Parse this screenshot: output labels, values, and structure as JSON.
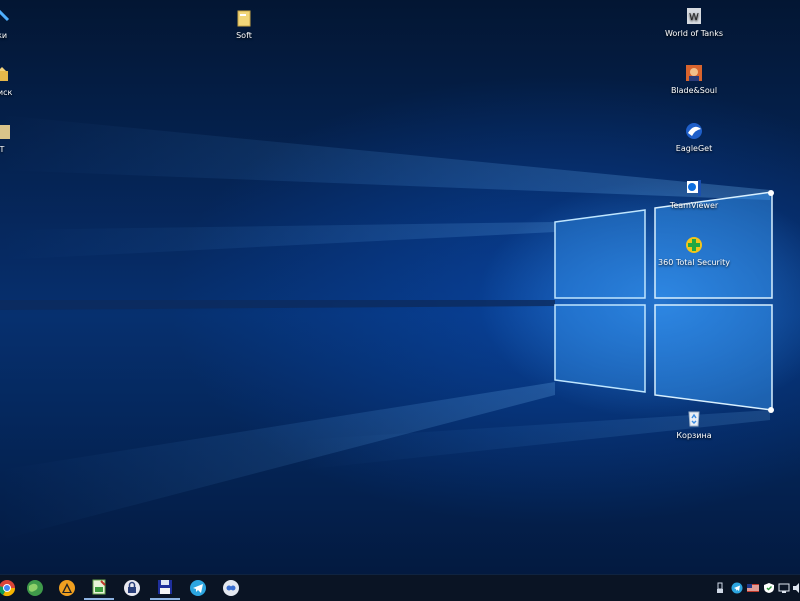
{
  "desktop": {
    "icons": [
      {
        "name": "desktop-icon-partial-1",
        "label": "зки"
      },
      {
        "name": "desktop-icon-yandex-disk",
        "label": "Диск"
      },
      {
        "name": "desktop-icon-partial-3",
        "label": "T"
      },
      {
        "name": "desktop-icon-soft",
        "label": "Soft"
      },
      {
        "name": "desktop-icon-world-of-tanks",
        "label": "World of Tanks"
      },
      {
        "name": "desktop-icon-blade-and-soul",
        "label": "Blade&Soul"
      },
      {
        "name": "desktop-icon-eagleget",
        "label": "EagleGet"
      },
      {
        "name": "desktop-icon-teamviewer",
        "label": "TeamViewer"
      },
      {
        "name": "desktop-icon-360-total-security",
        "label": "360 Total Security"
      },
      {
        "name": "desktop-icon-recycle-bin",
        "label": "Корзина"
      }
    ]
  },
  "taskbar": {
    "pinned": [
      {
        "name": "taskbar-chrome-button",
        "icon": "chrome-icon"
      },
      {
        "name": "taskbar-globe-button",
        "icon": "globe-icon"
      },
      {
        "name": "taskbar-aimp-button",
        "icon": "aimp-icon"
      },
      {
        "name": "taskbar-image-editor-button",
        "icon": "image-editor-icon",
        "active": true
      },
      {
        "name": "taskbar-lock-button",
        "icon": "lock-icon"
      },
      {
        "name": "taskbar-save-button",
        "icon": "floppy-icon",
        "active": true
      },
      {
        "name": "taskbar-telegram-button",
        "icon": "telegram-icon"
      },
      {
        "name": "taskbar-cloud-button",
        "icon": "cloud-app-icon"
      }
    ],
    "tray": [
      {
        "name": "tray-usb-icon"
      },
      {
        "name": "tray-telegram-icon"
      },
      {
        "name": "tray-flag-us-icon"
      },
      {
        "name": "tray-shield-icon"
      },
      {
        "name": "tray-network-icon"
      },
      {
        "name": "tray-volume-icon"
      }
    ]
  }
}
